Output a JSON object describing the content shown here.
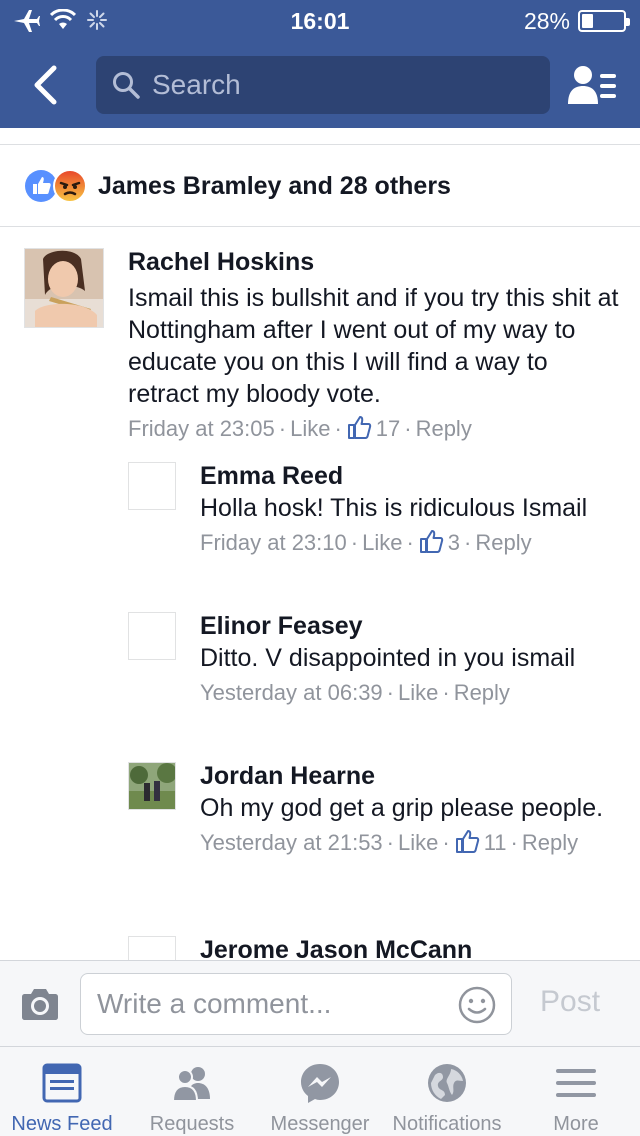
{
  "status_bar": {
    "time": "16:01",
    "battery": "28%",
    "battery_level": 0.28
  },
  "nav": {
    "search_placeholder": "Search"
  },
  "reactions": {
    "summary": "James Bramley and 28 others",
    "types": [
      "like",
      "angry"
    ]
  },
  "comments": [
    {
      "author": "Rachel Hoskins",
      "text": "Ismail this is bullshit and if you try this shit at Nottingham after I went out of my way to educate you on this I will find a way to retract my bloody vote.",
      "time": "Friday at 23:05",
      "like_label": "Like",
      "likes": "17",
      "reply_label": "Reply"
    },
    {
      "author": "Emma Reed",
      "text": "Holla hosk! This is ridiculous Ismail",
      "time": "Friday at 23:10",
      "like_label": "Like",
      "likes": "3",
      "reply_label": "Reply"
    },
    {
      "author": "Elinor Feasey",
      "text": "Ditto. V disappointed in you ismail",
      "time": "Yesterday at 06:39",
      "like_label": "Like",
      "reply_label": "Reply"
    },
    {
      "author": "Jordan Hearne",
      "text": "Oh my god get a grip please people.",
      "time": "Yesterday at 21:53",
      "like_label": "Like",
      "likes": "11",
      "reply_label": "Reply"
    },
    {
      "author": "Jerome Jason McCann"
    }
  ],
  "composer": {
    "placeholder": "Write a comment...",
    "post_label": "Post"
  },
  "tabs": [
    {
      "label": "News Feed",
      "icon": "news-feed-icon",
      "active": true
    },
    {
      "label": "Requests",
      "icon": "friend-requests-icon"
    },
    {
      "label": "Messenger",
      "icon": "messenger-icon"
    },
    {
      "label": "Notifications",
      "icon": "globe-icon"
    },
    {
      "label": "More",
      "icon": "hamburger-icon"
    }
  ],
  "colors": {
    "brand": "#3b5998",
    "active_tab": "#4267b2",
    "meta": "#90949c"
  }
}
